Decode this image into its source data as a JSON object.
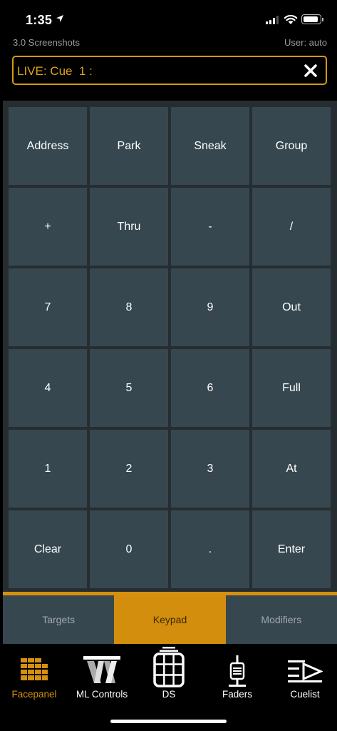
{
  "status": {
    "time": "1:35"
  },
  "header": {
    "show_name": "3.0 Screenshots",
    "user": "User: auto"
  },
  "command_line": {
    "text": "LIVE: Cue  1 :"
  },
  "keypad": {
    "keys": [
      "Address",
      "Park",
      "Sneak",
      "Group",
      "+",
      "Thru",
      "-",
      "/",
      "7",
      "8",
      "9",
      "Out",
      "4",
      "5",
      "6",
      "Full",
      "1",
      "2",
      "3",
      "At",
      "Clear",
      "0",
      ".",
      "Enter"
    ]
  },
  "tabs": [
    {
      "label": "Targets",
      "active": false
    },
    {
      "label": "Keypad",
      "active": true
    },
    {
      "label": "Modifiers",
      "active": false
    }
  ],
  "nav": [
    {
      "label": "Facepanel",
      "icon": "facepanel-icon",
      "active": true
    },
    {
      "label": "ML Controls",
      "icon": "ml-controls-icon",
      "active": false
    },
    {
      "label": "DS",
      "icon": "direct-selects-icon",
      "active": false
    },
    {
      "label": "Faders",
      "icon": "faders-icon",
      "active": false
    },
    {
      "label": "Cuelist",
      "icon": "cuelist-icon",
      "active": false
    }
  ],
  "colors": {
    "accent": "#d4900e",
    "key_bg": "#37474f",
    "panel_bg": "#262d31",
    "cmd_text": "#e0a21a"
  }
}
